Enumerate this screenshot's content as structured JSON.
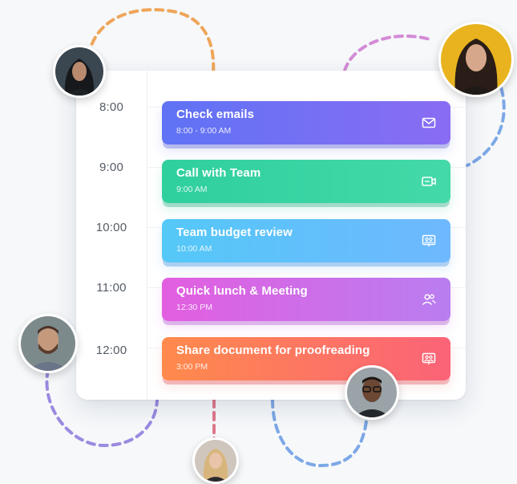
{
  "colors": {
    "email_event": "#7b6ff4",
    "call_event": "#38d4a3",
    "budget_event": "#5ec0fb",
    "lunch_event": "#cc6ee8",
    "document_event": "#fd7567",
    "dash_orange": "#efa559",
    "dash_pink": "#d48bd6",
    "dash_blue": "#7da8e6",
    "dash_purple": "#9a8ae0",
    "dash_red": "#e0788a"
  },
  "schedule": {
    "time_labels": [
      "8:00",
      "9:00",
      "10:00",
      "11:00",
      "12:00"
    ],
    "events": [
      {
        "title": "Check emails",
        "time": "8:00 - 9:00 AM",
        "icon": "mail-icon"
      },
      {
        "title": "Call with Team",
        "time": "9:00 AM",
        "icon": "video-call-icon"
      },
      {
        "title": "Team budget review",
        "time": "10:00 AM",
        "icon": "presentation-icon"
      },
      {
        "title": "Quick lunch & Meeting",
        "time": "12:30 PM",
        "icon": "people-icon"
      },
      {
        "title": "Share document for proofreading",
        "time": "3:00 PM",
        "icon": "presentation-icon"
      }
    ]
  },
  "avatars": [
    "avatar-woman-dark-hair",
    "avatar-woman-yellow-bg",
    "avatar-man-beard",
    "avatar-woman-blonde",
    "avatar-man-glasses"
  ]
}
